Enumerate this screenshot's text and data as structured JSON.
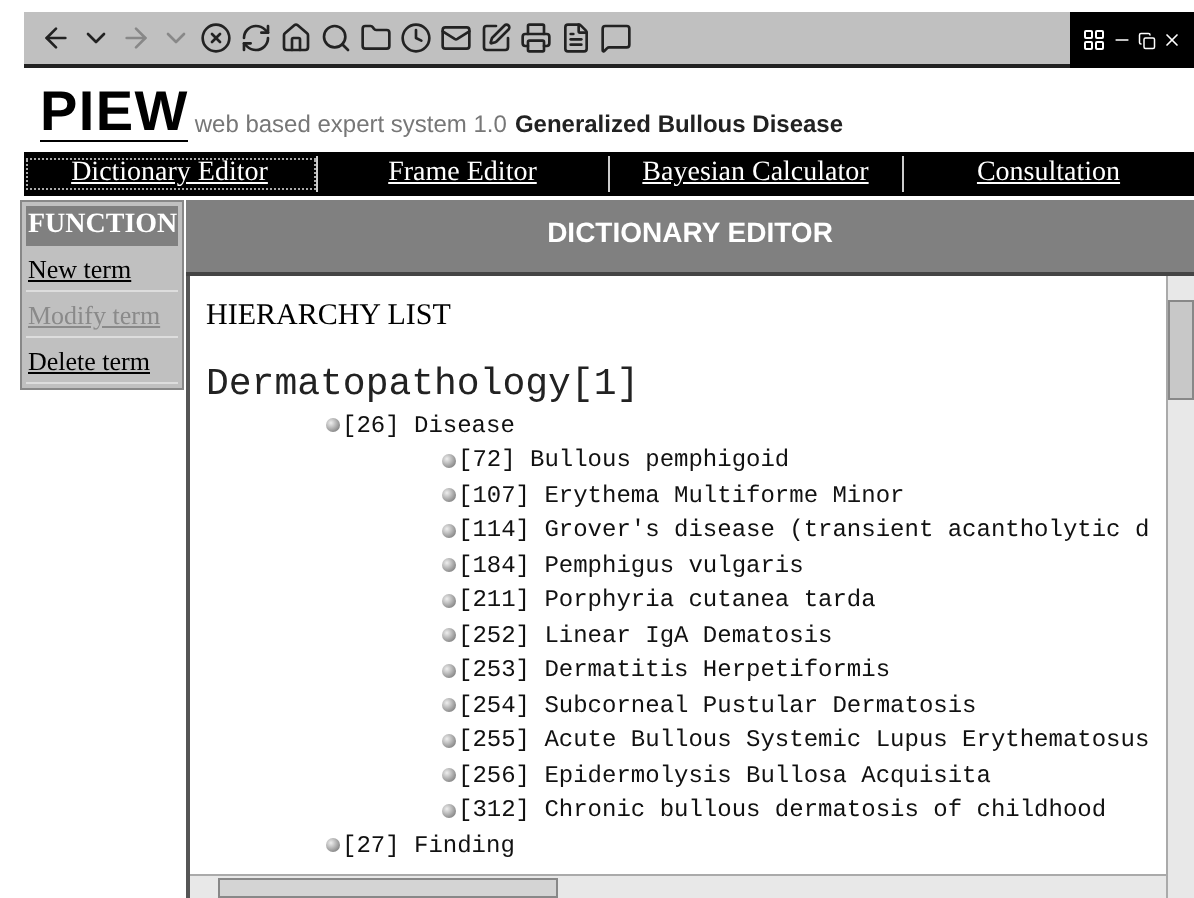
{
  "app": {
    "logo": "PIEW",
    "subtitle": "web based expert system 1.0",
    "topic": "Generalized Bullous Disease"
  },
  "nav": [
    {
      "label": "Dictionary Editor",
      "selected": true
    },
    {
      "label": "Frame Editor",
      "selected": false
    },
    {
      "label": "Bayesian Calculator",
      "selected": false
    },
    {
      "label": "Consultation",
      "selected": false
    }
  ],
  "sidebar": {
    "title": "FUNCTION",
    "items": [
      {
        "label": "New term",
        "disabled": false
      },
      {
        "label": "Modify term",
        "disabled": true
      },
      {
        "label": "Delete term",
        "disabled": false
      }
    ]
  },
  "panel": {
    "title": "DICTIONARY EDITOR",
    "heading": "HIERARCHY LIST",
    "root": "Dermatopathology[1]",
    "tree": [
      {
        "label": "[26] Disease",
        "children": [
          {
            "label": "[72] Bullous pemphigoid"
          },
          {
            "label": "[107] Erythema Multiforme Minor"
          },
          {
            "label": "[114] Grover's disease (transient acantholytic d"
          },
          {
            "label": "[184] Pemphigus vulgaris"
          },
          {
            "label": "[211] Porphyria cutanea tarda"
          },
          {
            "label": "[252] Linear IgA Dematosis"
          },
          {
            "label": "[253] Dermatitis Herpetiformis"
          },
          {
            "label": "[254] Subcorneal Pustular Dermatosis"
          },
          {
            "label": "[255] Acute Bullous Systemic Lupus Erythematosus"
          },
          {
            "label": "[256] Epidermolysis Bullosa Acquisita"
          },
          {
            "label": "[312] Chronic bullous dermatosis of childhood"
          }
        ]
      },
      {
        "label": "[27] Finding"
      }
    ]
  }
}
